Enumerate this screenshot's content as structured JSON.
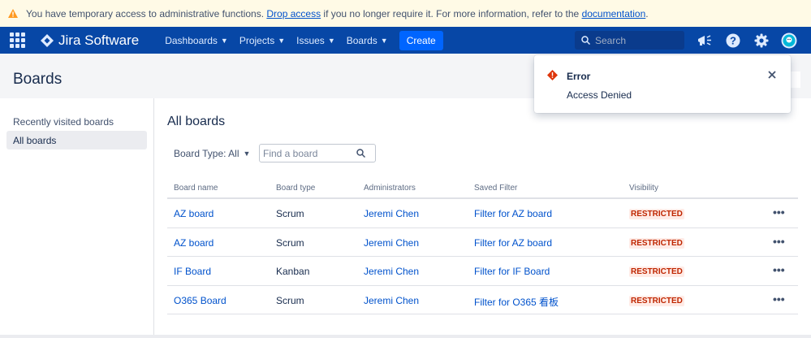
{
  "banner": {
    "text_before": "You have temporary access to administrative functions. ",
    "drop_link": "Drop access",
    "text_middle": " if you no longer require it. For more information, refer to the ",
    "doc_link": "documentation",
    "text_after": "."
  },
  "nav": {
    "brand": "Jira Software",
    "items": [
      "Dashboards",
      "Projects",
      "Issues",
      "Boards"
    ],
    "create": "Create",
    "search_placeholder": "Search"
  },
  "page": {
    "title": "Boards"
  },
  "sidebar": {
    "items": [
      "Recently visited boards",
      "All boards"
    ],
    "active": "All boards"
  },
  "main": {
    "title": "All boards",
    "board_type_filter": "Board Type: All",
    "find_placeholder": "Find a board"
  },
  "table": {
    "headers": [
      "Board name",
      "Board type",
      "Administrators",
      "Saved Filter",
      "Visibility"
    ],
    "rows": [
      {
        "name": "AZ board",
        "type": "Scrum",
        "admin": "Jeremi Chen",
        "filter": "Filter for AZ board",
        "visibility": "RESTRICTED"
      },
      {
        "name": "AZ board",
        "type": "Scrum",
        "admin": "Jeremi Chen",
        "filter": "Filter for AZ board",
        "visibility": "RESTRICTED"
      },
      {
        "name": "IF Board",
        "type": "Kanban",
        "admin": "Jeremi Chen",
        "filter": "Filter for IF Board",
        "visibility": "RESTRICTED"
      },
      {
        "name": "O365 Board",
        "type": "Scrum",
        "admin": "Jeremi Chen",
        "filter": "Filter for O365 看板",
        "visibility": "RESTRICTED"
      }
    ]
  },
  "flag": {
    "title": "Error",
    "message": "Access Denied"
  },
  "colors": {
    "nav_bg": "#0747a6",
    "banner_bg": "#fffae6",
    "link": "#0052cc",
    "restricted_bg": "#ffebe6",
    "restricted_text": "#bf2600",
    "error": "#de350b"
  },
  "icons": [
    "warning-icon",
    "app-switcher-icon",
    "jira-logo-icon",
    "search-icon",
    "megaphone-icon",
    "help-icon",
    "settings-icon",
    "avatar-icon",
    "error-icon",
    "close-icon",
    "more-icon"
  ]
}
